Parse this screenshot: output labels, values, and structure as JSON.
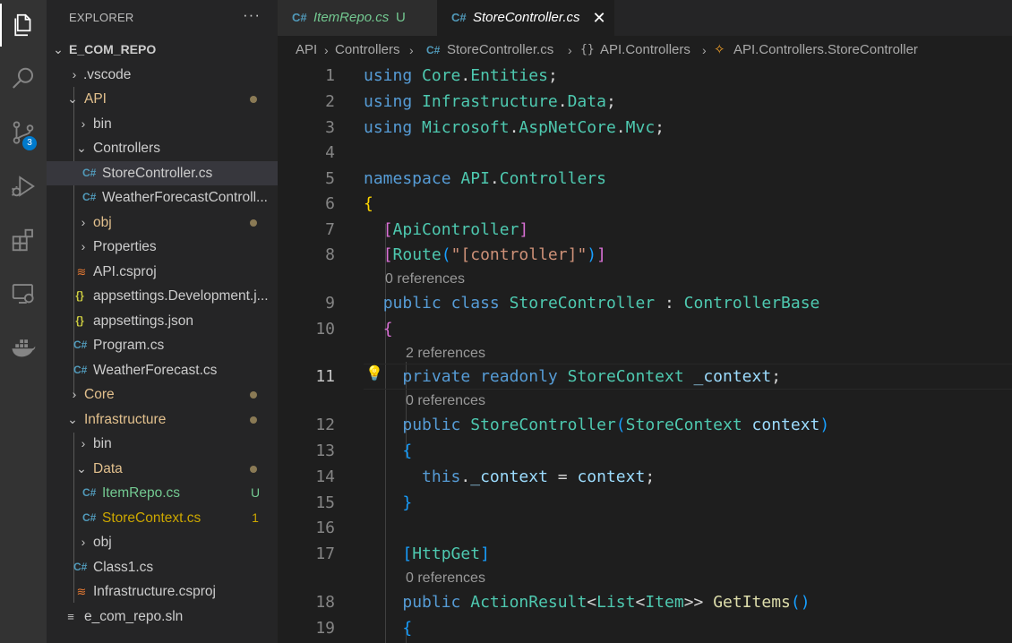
{
  "activity_bar": {
    "items": [
      {
        "name": "explorer-icon",
        "active": true
      },
      {
        "name": "search-icon"
      },
      {
        "name": "source-control-icon",
        "badge": "3"
      },
      {
        "name": "run-debug-icon"
      },
      {
        "name": "extensions-icon"
      },
      {
        "name": "remote-explorer-icon"
      },
      {
        "name": "docker-icon"
      }
    ]
  },
  "sidebar": {
    "title": "EXPLORER",
    "more": "···",
    "tree": [
      {
        "label": "E_COM_REPO",
        "bold": true
      },
      {
        "label": ".vscode"
      },
      {
        "label": "API"
      },
      {
        "label": "bin"
      },
      {
        "label": "Controllers"
      },
      {
        "label": "StoreController.cs"
      },
      {
        "label": "WeatherForecastControll..."
      },
      {
        "label": "obj"
      },
      {
        "label": "Properties"
      },
      {
        "label": "API.csproj"
      },
      {
        "label": "appsettings.Development.j..."
      },
      {
        "label": "appsettings.json"
      },
      {
        "label": "Program.cs"
      },
      {
        "label": "WeatherForecast.cs"
      },
      {
        "label": "Core"
      },
      {
        "label": "Infrastructure"
      },
      {
        "label": "bin"
      },
      {
        "label": "Data"
      },
      {
        "label": "ItemRepo.cs",
        "badge": "U"
      },
      {
        "label": "StoreContext.cs",
        "badge": "1"
      },
      {
        "label": "obj"
      },
      {
        "label": "Class1.cs"
      },
      {
        "label": "Infrastructure.csproj"
      },
      {
        "label": "e_com_repo.sln"
      }
    ]
  },
  "tabs": [
    {
      "label": "ItemRepo.cs",
      "modifier": "U"
    },
    {
      "label": "StoreController.cs",
      "active": true
    }
  ],
  "breadcrumb": [
    "API",
    "Controllers",
    "StoreController.cs",
    "API.Controllers",
    "API.Controllers.StoreController"
  ],
  "editor": {
    "line_numbers": [
      "1",
      "2",
      "3",
      "4",
      "5",
      "6",
      "7",
      "8",
      "9",
      "10",
      "11",
      "12",
      "13",
      "14",
      "15",
      "16",
      "17",
      "18",
      "19"
    ],
    "current_line": "11",
    "lenses": [
      "0 references",
      "2 references",
      "0 references",
      "0 references"
    ]
  },
  "colors": {
    "activity_bar": "#333333",
    "sidebar": "#252526",
    "editor": "#1e1e1e",
    "accent": "#007acc",
    "keyword": "#569cd6",
    "type": "#4ec9b0",
    "untracked": "#73c991",
    "modified": "#e2c08d"
  }
}
